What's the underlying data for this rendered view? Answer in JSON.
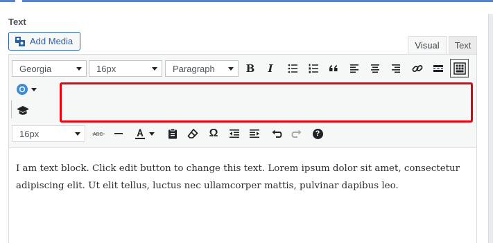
{
  "section": {
    "label": "Text"
  },
  "media": {
    "add_media_label": "Add Media"
  },
  "tabs": {
    "visual": "Visual",
    "text": "Text"
  },
  "toolbar": {
    "font_family": "Georgia",
    "font_size": "16px",
    "format": "Paragraph",
    "font_size_row3": "16px",
    "bold_glyph": "B",
    "italic_glyph": "I",
    "omega_glyph": "Ω",
    "help_glyph": "?"
  },
  "content": {
    "paragraph": "I am text block. Click edit button to change this text. Lorem ipsum dolor sit amet, consectetur adipiscing elit. Ut elit tellus, luctus nec ullamcorper mattis, pulvinar dapibus leo."
  },
  "colors": {
    "accent": "#2b5ea8",
    "highlight": "#e8000f",
    "topbar": "#5b82c6",
    "plugin_blue": "#3b8bd9"
  }
}
